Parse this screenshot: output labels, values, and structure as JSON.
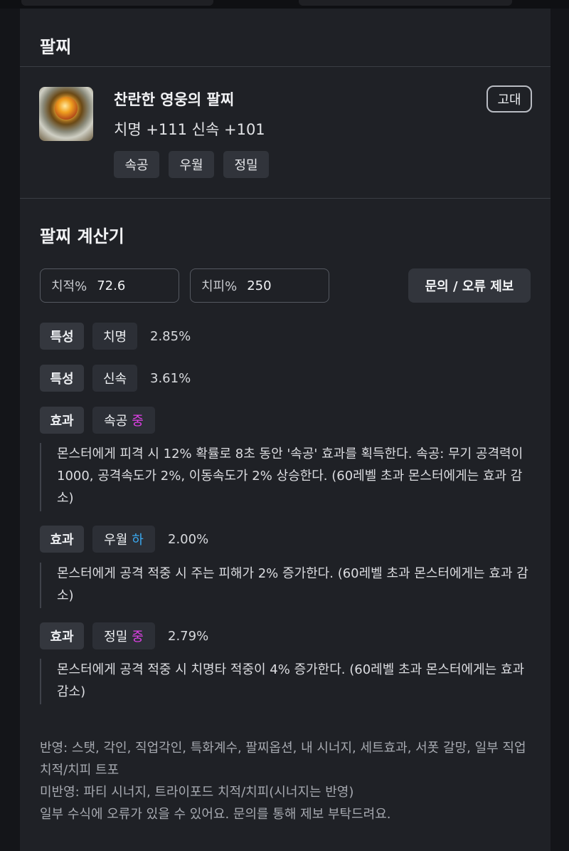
{
  "card": {
    "title": "팔찌"
  },
  "item": {
    "name": "찬란한 영웅의 팔찌",
    "stats": "치명 +111  신속 +101",
    "grade": "고대",
    "tags": [
      "속공",
      "우월",
      "정밀"
    ]
  },
  "calculator": {
    "title": "팔찌 계산기",
    "crit_rate": {
      "label": "치적%",
      "value": "72.6"
    },
    "crit_dmg": {
      "label": "치피%",
      "value": "250"
    },
    "report_button": "문의 / 오류 제보",
    "rows": [
      {
        "kind": "특성",
        "name": "치명",
        "value": "2.85%"
      },
      {
        "kind": "특성",
        "name": "신속",
        "value": "3.61%"
      },
      {
        "kind": "효과",
        "name": "속공",
        "level": "중",
        "value": "",
        "desc": "몬스터에게 피격 시 12% 확률로 8초 동안 '속공' 효과를 획득한다. 속공: 무기 공격력이 1000, 공격속도가 2%, 이동속도가 2% 상승한다. (60레벨 초과 몬스터에게는 효과 감소)"
      },
      {
        "kind": "효과",
        "name": "우월",
        "level": "하",
        "value": "2.00%",
        "desc": "몬스터에게 공격 적중 시 주는 피해가 2% 증가한다. (60레벨 초과 몬스터에게는 효과 감소)"
      },
      {
        "kind": "효과",
        "name": "정밀",
        "level": "중",
        "value": "2.79%",
        "desc": "몬스터에게 공격 적중 시 치명타 적중이 4% 증가한다. (60레벨 초과 몬스터에게는 효과 감소)"
      }
    ]
  },
  "footnote": {
    "applied": "반영: 스탯, 각인, 직업각인, 특화계수, 팔찌옵션, 내 시너지, 세트효과, 서폿 갈망, 일부 직업 치적/치피 트포",
    "not_applied": "미반영: 파티 시너지, 트라이포드 치적/치피(시너지는 반영)",
    "notice": "일부 수식에 오류가 있을 수 있어요. 문의를 통해 제보 부탁드려요."
  },
  "colors": {
    "level_mid": "#e040e8",
    "level_low": "#3aa8f0",
    "card_bg": "#1f2126"
  },
  "icons": {
    "item": "bracelet-icon"
  }
}
